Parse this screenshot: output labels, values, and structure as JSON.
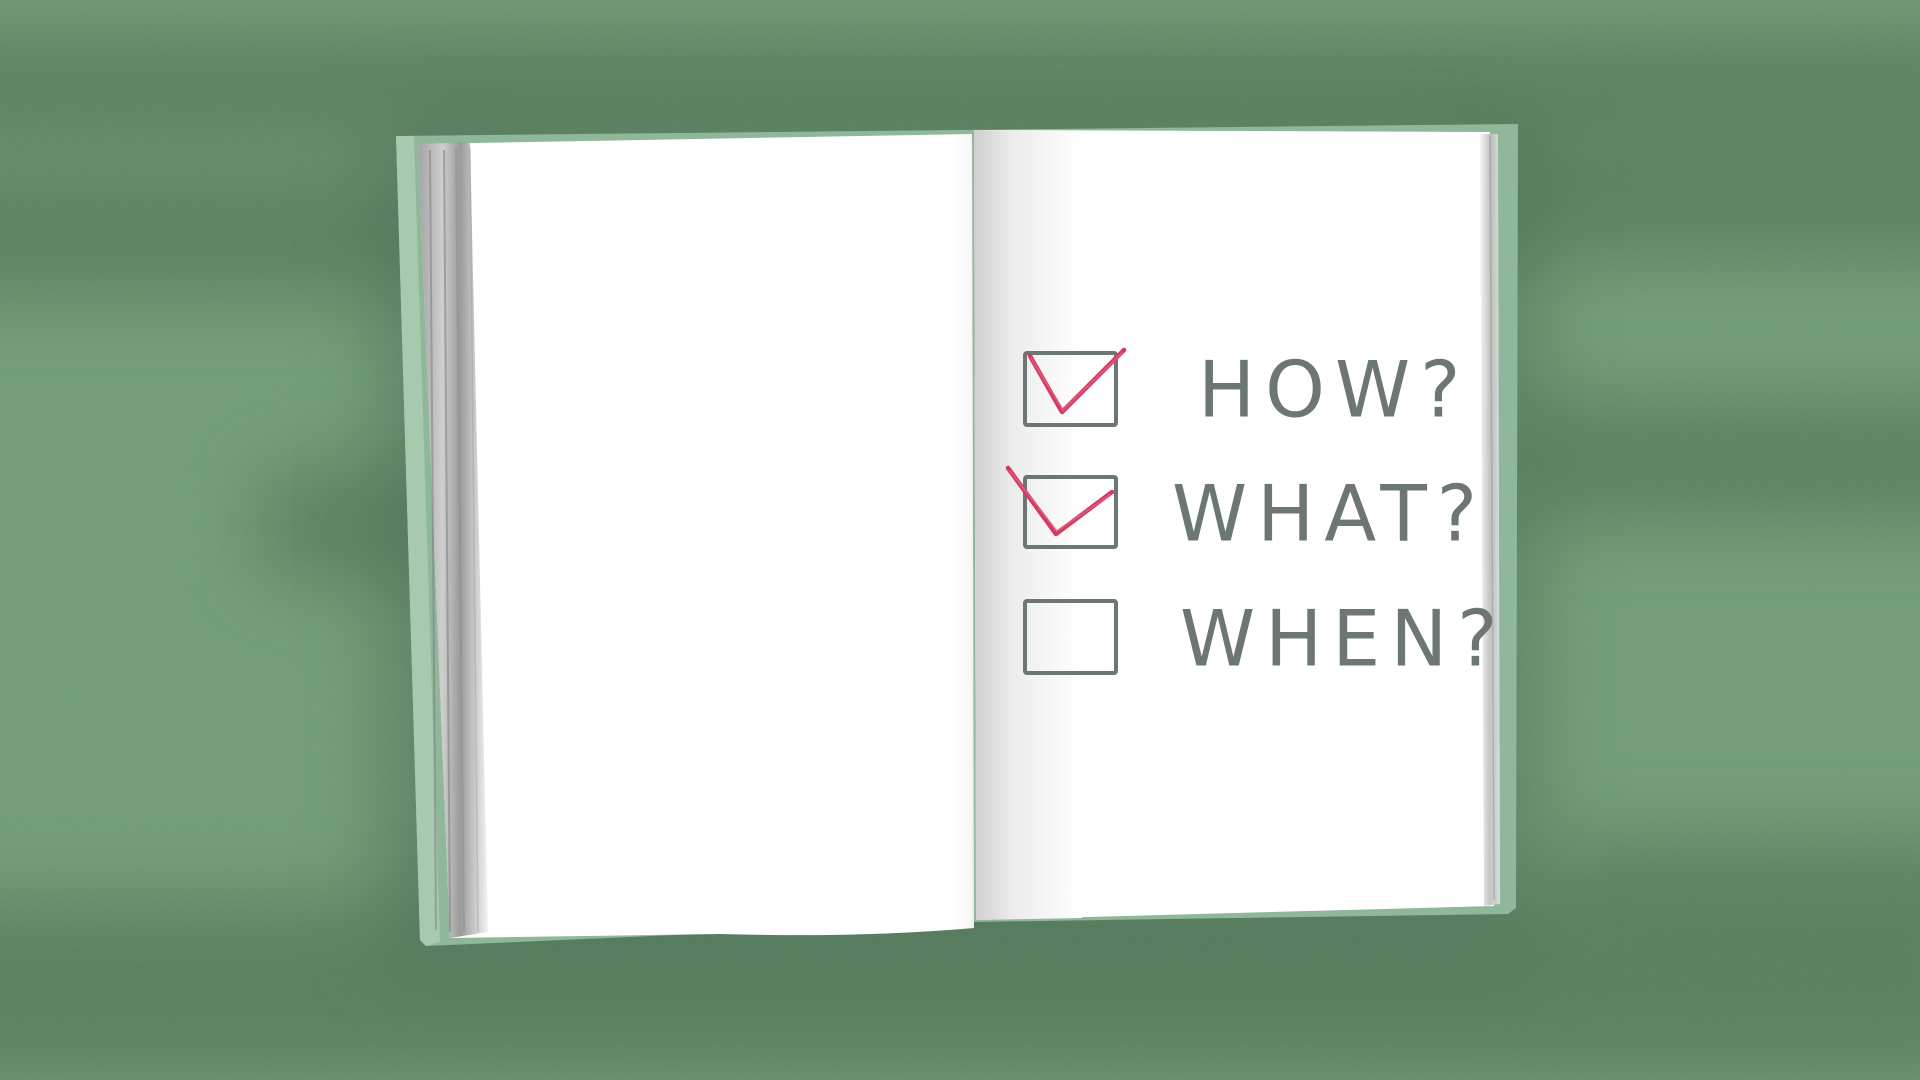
{
  "checklist": {
    "items": [
      {
        "label": "HOW?",
        "checked": true
      },
      {
        "label": "WHAT?",
        "checked": true
      },
      {
        "label": "WHEN?",
        "checked": false
      }
    ]
  },
  "colors": {
    "background": "#6f9a72",
    "background_dark": "#4f7556",
    "book_cover": "#8fb79a",
    "page": "#ffffff",
    "text": "#6c7675",
    "check_mark": "#d33a62",
    "box_outline": "#6c7675"
  }
}
